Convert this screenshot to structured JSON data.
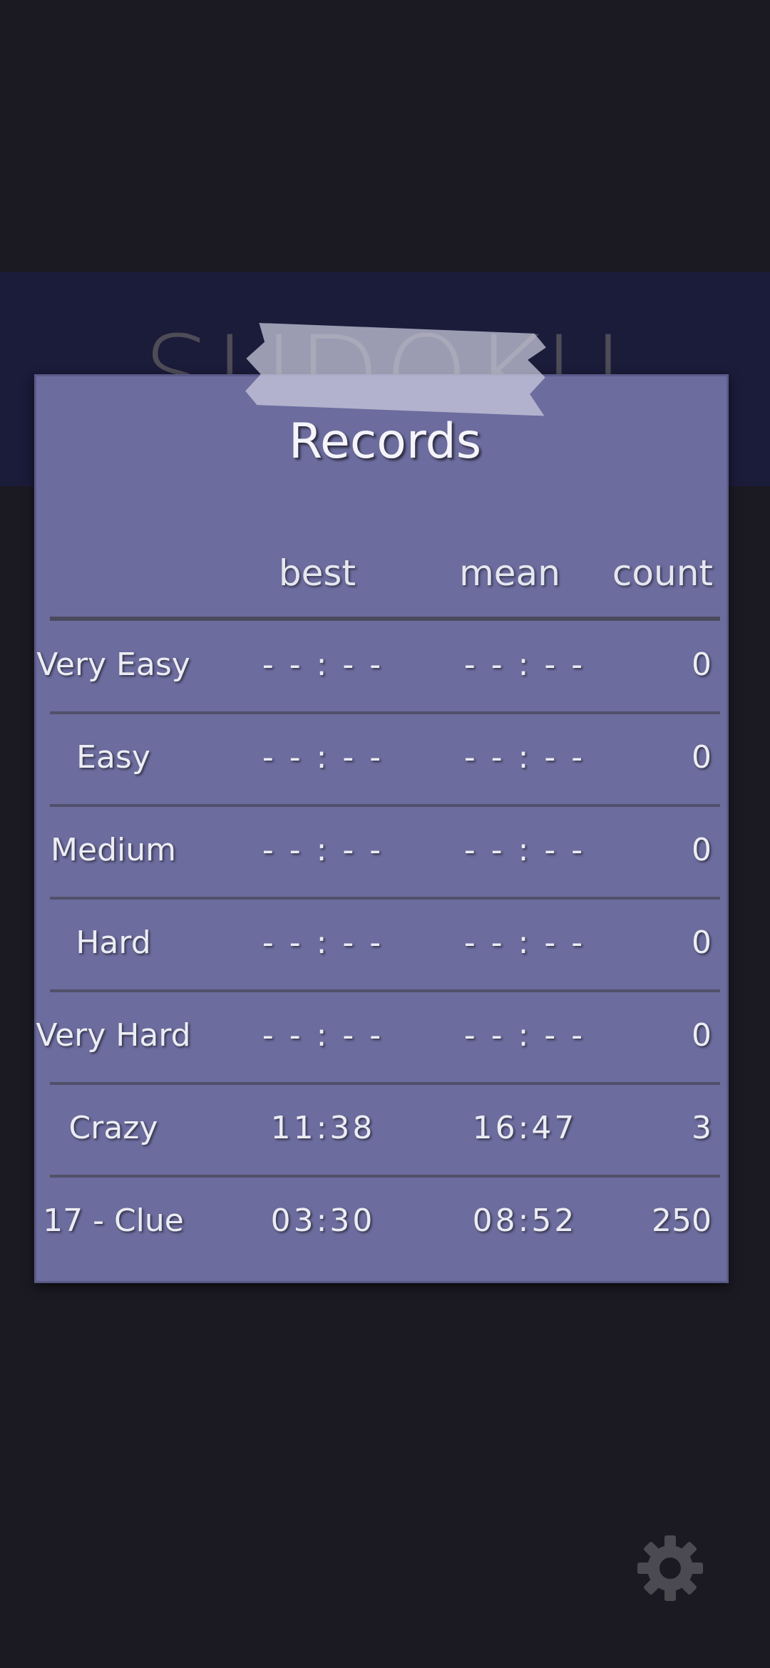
{
  "background_title": "SUDOKU",
  "records": {
    "title": "Records",
    "headers": {
      "best": "best",
      "mean": "mean",
      "count": "count"
    },
    "rows": [
      {
        "level": "Very Easy",
        "best": "- - : - -",
        "mean": "- - : - -",
        "count": "0"
      },
      {
        "level": "Easy",
        "best": "- - : - -",
        "mean": "- - : - -",
        "count": "0"
      },
      {
        "level": "Medium",
        "best": "- - : - -",
        "mean": "- - : - -",
        "count": "0"
      },
      {
        "level": "Hard",
        "best": "- - : - -",
        "mean": "- - : - -",
        "count": "0"
      },
      {
        "level": "Very Hard",
        "best": "- - : - -",
        "mean": "- - : - -",
        "count": "0"
      },
      {
        "level": "Crazy",
        "best": "11:38",
        "mean": "16:47",
        "count": "3"
      },
      {
        "level": "17 - Clue",
        "best": "03:30",
        "mean": "08:52",
        "count": "250"
      }
    ]
  },
  "settings_icon": "gear-icon",
  "colors": {
    "background": "#1b1a23",
    "banner": "#1b1b3a",
    "panel": "#6c6c9e",
    "text": "#ececf4"
  }
}
